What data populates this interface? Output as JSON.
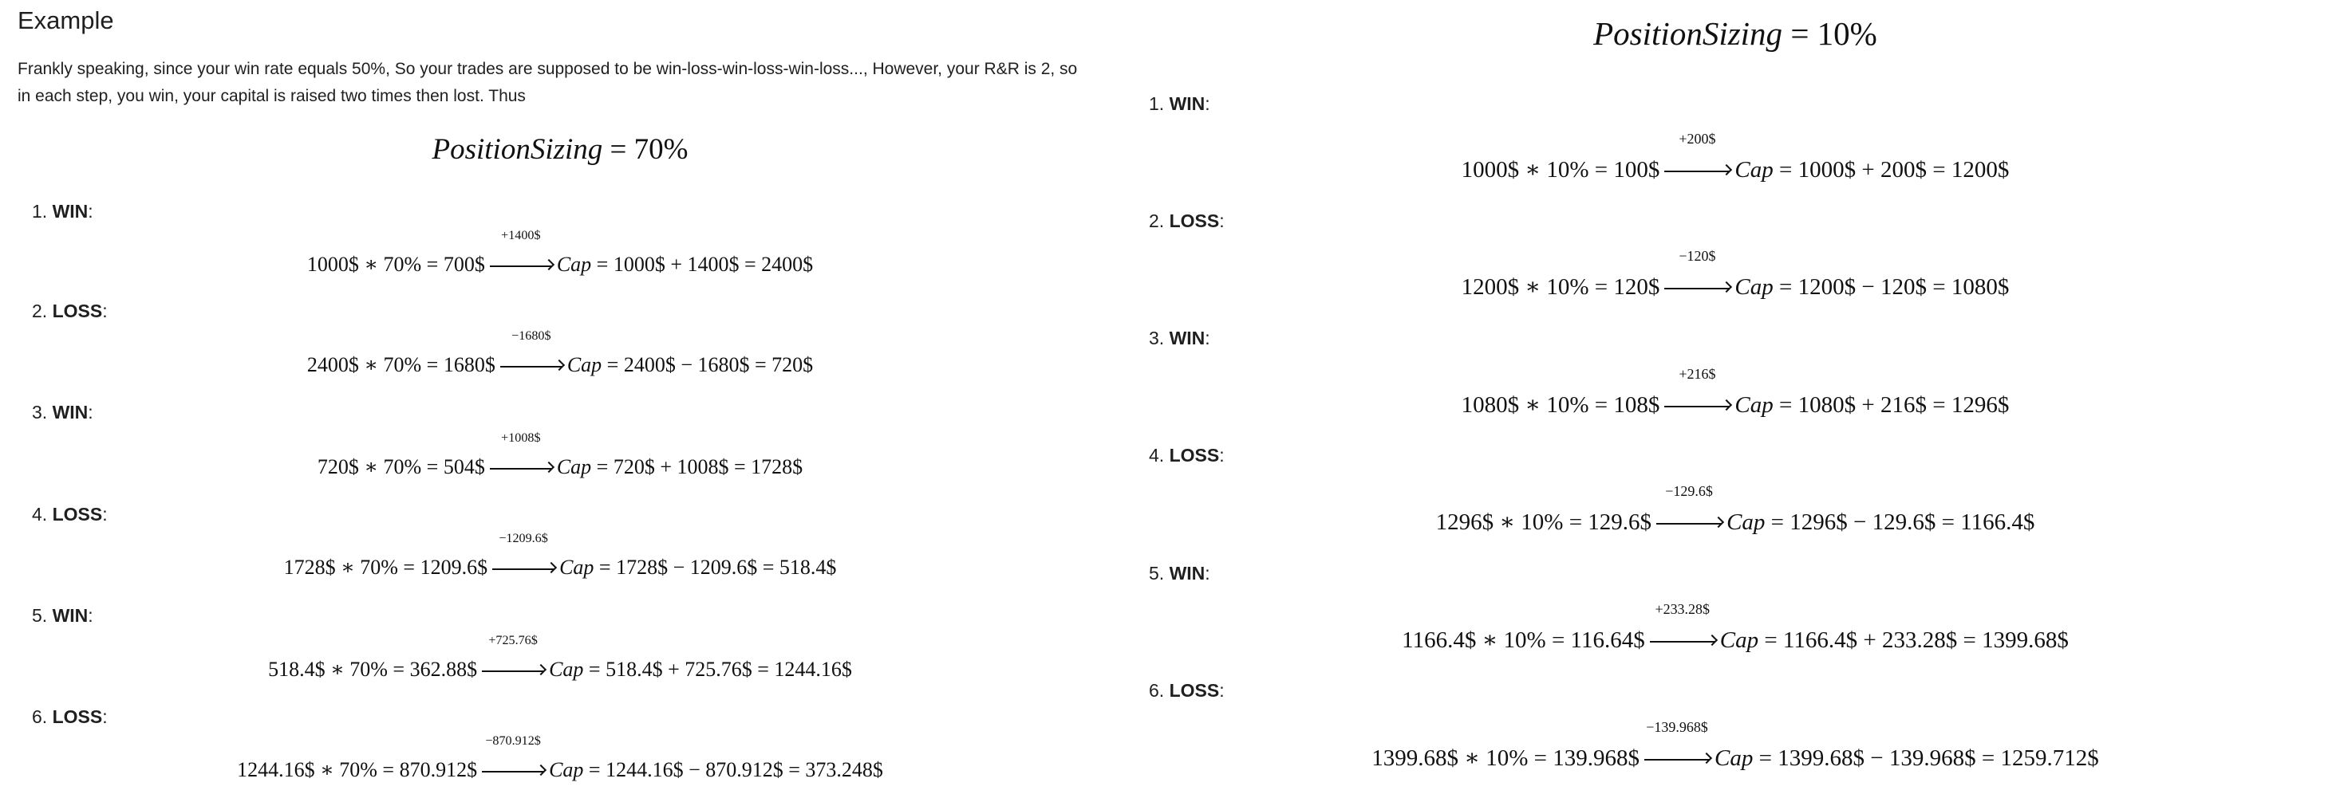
{
  "left": {
    "title": "Example",
    "intro": "Frankly speaking, since your win rate equals 50%, So your trades are supposed to be win-loss-win-loss-win-loss..., However, your R&R is 2, so in each step, you win, your capital is raised two times then lost. Thus",
    "heading": {
      "var": "PositionSizing",
      "rest": " = 70%"
    },
    "steps": [
      {
        "num": "1.",
        "label": "WIN",
        "lhs": "1000$ ∗ 70% = 700$",
        "arrow": "+1400$",
        "cap": "Cap",
        "rhs": " = 1000$ + 1400$ = 2400$"
      },
      {
        "num": "2.",
        "label": "LOSS",
        "lhs": "2400$ ∗ 70% = 1680$",
        "arrow": "−1680$",
        "cap": "Cap",
        "rhs": " = 2400$ − 1680$ = 720$"
      },
      {
        "num": "3.",
        "label": "WIN",
        "lhs": "720$ ∗ 70% = 504$",
        "arrow": "+1008$",
        "cap": "Cap",
        "rhs": " = 720$ + 1008$ = 1728$"
      },
      {
        "num": "4.",
        "label": "LOSS",
        "lhs": "1728$ ∗ 70% = 1209.6$",
        "arrow": "−1209.6$",
        "cap": "Cap",
        "rhs": " = 1728$ − 1209.6$ = 518.4$"
      },
      {
        "num": "5.",
        "label": "WIN",
        "lhs": "518.4$ ∗ 70% = 362.88$",
        "arrow": "+725.76$",
        "cap": "Cap",
        "rhs": " = 518.4$ + 725.76$ = 1244.16$"
      },
      {
        "num": "6.",
        "label": "LOSS",
        "lhs": "1244.16$ ∗ 70% = 870.912$",
        "arrow": "−870.912$",
        "cap": "Cap",
        "rhs": " = 1244.16$ − 870.912$ = 373.248$"
      }
    ]
  },
  "right": {
    "heading": {
      "var": "PositionSizing",
      "rest": " = 10%"
    },
    "steps": [
      {
        "num": "1.",
        "label": "WIN",
        "lhs": "1000$ ∗ 10% = 100$",
        "arrow": "+200$",
        "cap": "Cap",
        "rhs": " = 1000$ + 200$ = 1200$"
      },
      {
        "num": "2.",
        "label": "LOSS",
        "lhs": "1200$ ∗ 10% = 120$",
        "arrow": "−120$",
        "cap": "Cap",
        "rhs": " = 1200$ − 120$ = 1080$"
      },
      {
        "num": "3.",
        "label": "WIN",
        "lhs": "1080$ ∗ 10% = 108$",
        "arrow": "+216$",
        "cap": "Cap",
        "rhs": " = 1080$ + 216$ = 1296$"
      },
      {
        "num": "4.",
        "label": "LOSS",
        "lhs": "1296$ ∗ 10% = 129.6$",
        "arrow": "−129.6$",
        "cap": "Cap",
        "rhs": " = 1296$ − 129.6$ = 1166.4$"
      },
      {
        "num": "5.",
        "label": "WIN",
        "lhs": "1166.4$ ∗ 10% = 116.64$",
        "arrow": "+233.28$",
        "cap": "Cap",
        "rhs": " = 1166.4$ + 233.28$ = 1399.68$"
      },
      {
        "num": "6.",
        "label": "LOSS",
        "lhs": "1399.68$ ∗ 10% = 139.968$",
        "arrow": "−139.968$",
        "cap": "Cap",
        "rhs": " = 1399.68$ − 139.968$ = 1259.712$"
      }
    ]
  }
}
